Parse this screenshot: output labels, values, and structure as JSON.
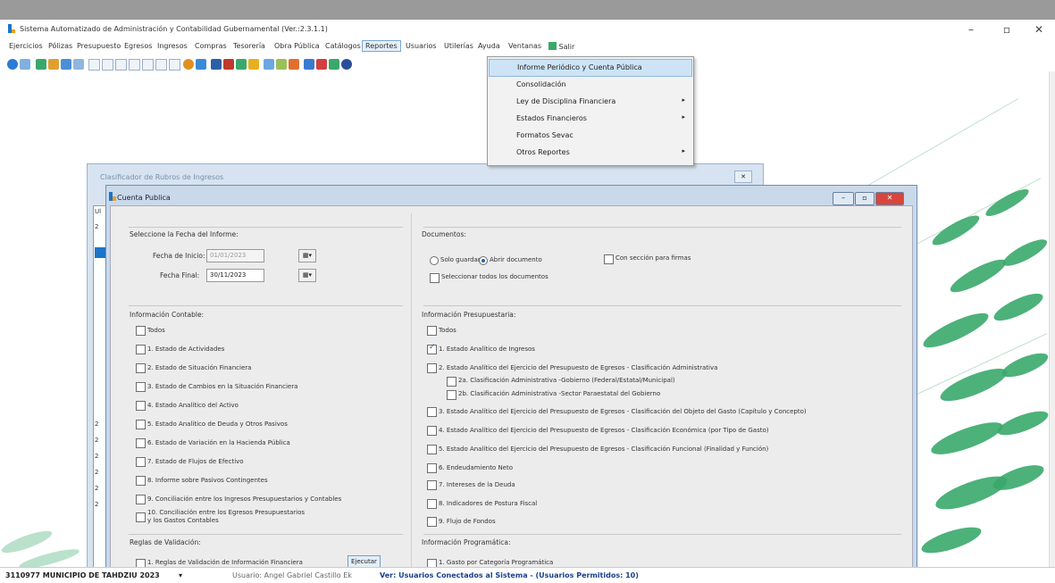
{
  "window": {
    "title": "Sistema Automatizado de Administración y Contabilidad Gubernamental (Ver.:2.3.1.1)",
    "minimize": "–",
    "maximize": "▫",
    "close": "✕"
  },
  "menubar": {
    "items": [
      "Ejercicios",
      "Pólizas",
      "Presupuesto",
      "Egresos",
      "Ingresos",
      "Compras",
      "Tesorería",
      "Obra Pública",
      "Catálogos",
      "Reportes",
      "Usuarios",
      "Utilerías",
      "Ayuda",
      "Ventanas",
      "Salir"
    ]
  },
  "reportes_menu": {
    "items": [
      {
        "label": "Informe Periódico y Cuenta Pública",
        "submenu": false
      },
      {
        "label": "Consolidación",
        "submenu": false
      },
      {
        "label": "Ley de Disciplina Financiera",
        "submenu": true
      },
      {
        "label": "Estados Financieros",
        "submenu": true
      },
      {
        "label": "Formatos Sevac",
        "submenu": false
      },
      {
        "label": "Otros Reportes",
        "submenu": true
      }
    ]
  },
  "back_window": {
    "title": "Clasificador de Rubros de Ingresos",
    "close": "✕",
    "rows": [
      "Ul",
      "",
      "",
      "",
      "",
      "",
      "",
      "",
      "",
      "",
      "",
      "",
      "",
      "",
      "",
      "",
      "",
      "",
      "",
      "2",
      "2",
      "2",
      "2",
      "2",
      "2",
      "2"
    ]
  },
  "cuenta_publica": {
    "title": "Cuenta Publica",
    "fecha": {
      "heading": "Seleccione la Fecha del Informe:",
      "inicio_label": "Fecha de Inicio:",
      "inicio_value": "01/01/2023",
      "final_label": "Fecha Final:",
      "final_value": "30/11/2023"
    },
    "documentos": {
      "heading": "Documentos:",
      "solo_guardar": "Solo guardar",
      "abrir_documento": "Abrir documento",
      "con_seccion_firmas": "Con sección para firmas",
      "seleccionar_todos": "Seleccionar todos los documentos"
    },
    "contable": {
      "heading": "Información Contable:",
      "items": [
        {
          "label": "Todos",
          "checked": false
        },
        {
          "label": "1. Estado de Actividades",
          "checked": false
        },
        {
          "label": "2. Estado de Situación Financiera",
          "checked": false
        },
        {
          "label": "3. Estado de Cambios en la Situación Financiera",
          "checked": false
        },
        {
          "label": "4. Estado Analítico del Activo",
          "checked": false
        },
        {
          "label": "5. Estado Analítico de Deuda y Otros Pasivos",
          "checked": false
        },
        {
          "label": "6. Estado de Variación en la Hacienda Pública",
          "checked": false
        },
        {
          "label": "7. Estado de Flujos de Efectivo",
          "checked": false
        },
        {
          "label": "8. Informe sobre Pasivos Contingentes",
          "checked": false
        },
        {
          "label": "9. Conciliación entre los Ingresos Presupuestarios y Contables",
          "checked": false
        },
        {
          "label": "10. Conciliación entre los Egresos Presupuestarios",
          "label2": "y los Gastos Contables",
          "checked": false
        }
      ]
    },
    "presupuestaria": {
      "heading": "Información Presupuestaria:",
      "items": [
        {
          "label": "Todos",
          "checked": false,
          "indent": 0
        },
        {
          "label": "1. Estado Analítico de Ingresos",
          "checked": true,
          "indent": 0
        },
        {
          "label": "2. Estado Analítico del Ejercicio del Presupuesto de Egresos - Clasificación Administrativa",
          "checked": false,
          "indent": 0
        },
        {
          "label": "2a. Clasificación Administrativa -Gobierno (Federal/Estatal/Municipal)",
          "checked": false,
          "indent": 1
        },
        {
          "label": "2b. Clasificación Administrativa -Sector Paraestatal del Gobierno",
          "checked": false,
          "indent": 1
        },
        {
          "label": "3. Estado Analítico del Ejercicio del Presupuesto de Egresos - Clasificación del Objeto del Gasto (Capítulo y Concepto)",
          "checked": false,
          "indent": 0
        },
        {
          "label": "4. Estado Analítico del Ejercicio del Presupuesto de Egresos - Clasificación Económica (por Tipo de Gasto)",
          "checked": false,
          "indent": 0
        },
        {
          "label": "5. Estado Analítico del Ejercicio del Presupuesto de Egresos - Clasificación Funcional (Finalidad y Función)",
          "checked": false,
          "indent": 0
        },
        {
          "label": "6. Endeudamiento Neto",
          "checked": false,
          "indent": 0
        },
        {
          "label": "7. Intereses de la Deuda",
          "checked": false,
          "indent": 0
        },
        {
          "label": "8. Indicadores de Postura Fiscal",
          "checked": false,
          "indent": 0
        },
        {
          "label": "9. Flujo de Fondos",
          "checked": false,
          "indent": 0
        }
      ]
    },
    "reglas": {
      "heading": "Reglas de Validación:",
      "item": "1. Reglas de Validación de Información Financiera",
      "ejecutar": "Ejecutar"
    },
    "programatica": {
      "heading": "Información Programática:",
      "item": "1. Gasto por Categoría Programática"
    }
  },
  "status": {
    "entity": "3110977 MUNICIPIO DE TAHDZIU  2023",
    "user": "Usuario: Angel Gabriel Castillo Ek",
    "connected": "Ver: Usuarios Conectados al Sistema - (Usuarios Permitidos: 10)"
  },
  "colors": {
    "accent": "#3aa86b",
    "menu_highlight": "#cde4f7",
    "close_red": "#d9453b",
    "status_link": "#1a3f8c"
  }
}
